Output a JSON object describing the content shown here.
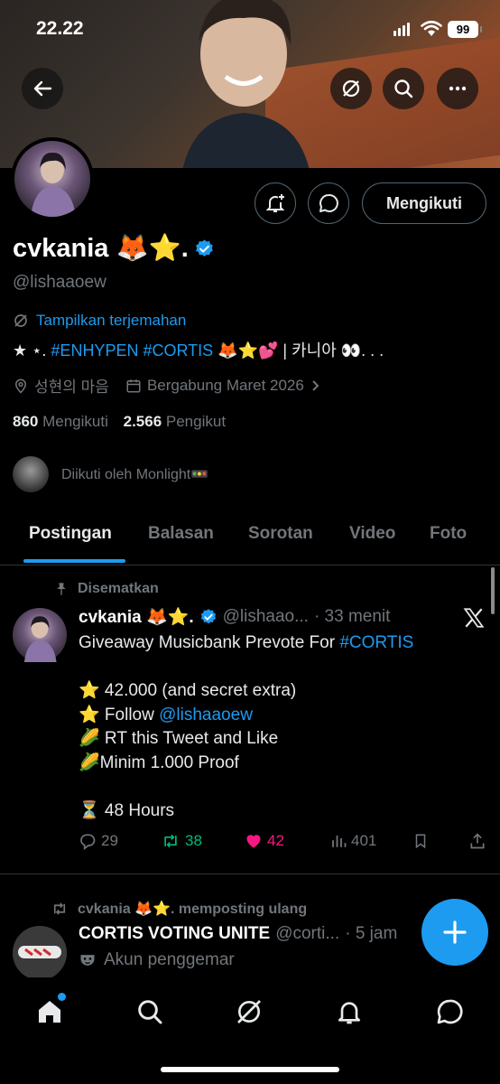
{
  "status": {
    "time": "22.22",
    "battery": "99"
  },
  "profile": {
    "name": "cvkania 🦊⭐.",
    "handle": "@lishaaoew",
    "follow_button": "Mengikuti",
    "translate_label": "Tampilkan terjemahan",
    "bio": {
      "prefix": "★ ⋆. ",
      "tag1": "#ENHYPEN",
      "tag2": "#CORTIS",
      "suffix": " 🦊⭐💕 | 카니아 👀. . ."
    },
    "location": "성현의 마음",
    "joined": "Bergabung Maret 2026",
    "following_count": "860",
    "following_label": "Mengikuti",
    "followers_count": "2.566",
    "followers_label": "Pengikut",
    "followed_by": "Diikuti oleh Monlight🚥"
  },
  "tabs": [
    "Postingan",
    "Balasan",
    "Sorotan",
    "Video",
    "Foto"
  ],
  "pinned_tweet": {
    "pinned_label": "Disematkan",
    "name": "cvkania 🦊⭐.",
    "handle": "@lishaao...",
    "time": "· 33 menit",
    "line1": "Giveaway Musicbank Prevote For ",
    "line1_tag": "#CORTIS",
    "line2": "⭐ 42.000 (and secret extra)",
    "line3": "⭐ Follow ",
    "line3_link": "@lishaaoew",
    "line4": "🌽 RT this Tweet and Like",
    "line5": "🌽Minim 1.000 Proof",
    "line6": "⏳ 48 Hours",
    "replies": "29",
    "reposts": "38",
    "likes": "42",
    "views": "401"
  },
  "second_tweet": {
    "repost_label": "cvkania 🦊⭐. memposting ulang",
    "name": "CORTIS VOTING UNITE",
    "handle": "@corti...",
    "time": "· 5 jam",
    "label": "Akun penggemar"
  },
  "colors": {
    "accent": "#1d9bf0",
    "like": "#f91880",
    "repost": "#00ba7c",
    "muted": "#71767b"
  }
}
